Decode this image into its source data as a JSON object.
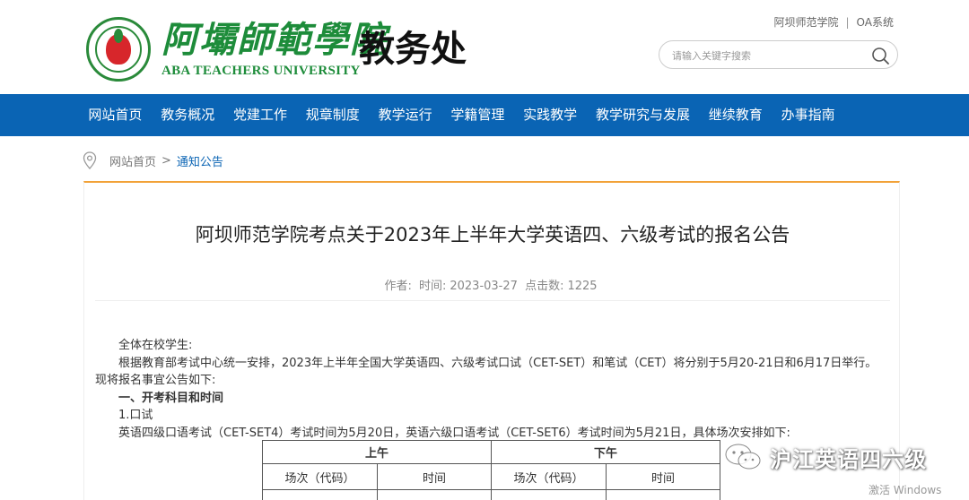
{
  "header": {
    "logo_cn": "阿壩師範學院",
    "logo_en": "ABA TEACHERS UNIVERSITY",
    "department": "教务处",
    "toplinks": [
      "阿坝师范学院",
      "OA系统"
    ],
    "search_placeholder": "请输入关键字搜索"
  },
  "nav": {
    "items": [
      "网站首页",
      "教务概况",
      "党建工作",
      "规章制度",
      "教学运行",
      "学籍管理",
      "实践教学",
      "教学研究与发展",
      "继续教育",
      "办事指南"
    ]
  },
  "breadcrumb": {
    "home": "网站首页",
    "arrow": ">",
    "current": "通知公告"
  },
  "article": {
    "title": "阿坝师范学院考点关于2023年上半年大学英语四、六级考试的报名公告",
    "meta_author": "作者:",
    "meta_time_label": "时间:",
    "meta_time": "2023-03-27",
    "meta_clicks_label": "点击数:",
    "meta_clicks": "1225",
    "paragraphs": [
      "全体在校学生:",
      "根据教育部考试中心统一安排，2023年上半年全国大学英语四、六级考试口试（CET-SET）和笔试（CET）将分别于5月20-21日和6月17日举行。现将报名事宜公告如下:",
      "一、开考科目和时间",
      "1.口试",
      "英语四级口语考试（CET-SET4）考试时间为5月20日，英语六级口语考试（CET-SET6）考试时间为5月21日，具体场次安排如下:"
    ],
    "table": {
      "am": "上午",
      "pm": "下午",
      "col_session": "场次（代码）",
      "col_time": "时间"
    }
  },
  "watermark": {
    "text": "沪江英语四六级"
  },
  "system": {
    "activate": "激活 Windows"
  },
  "colors": {
    "nav_blue": "#0a64b4",
    "accent_orange": "#f2a238",
    "logo_green": "#1d8c3a"
  }
}
